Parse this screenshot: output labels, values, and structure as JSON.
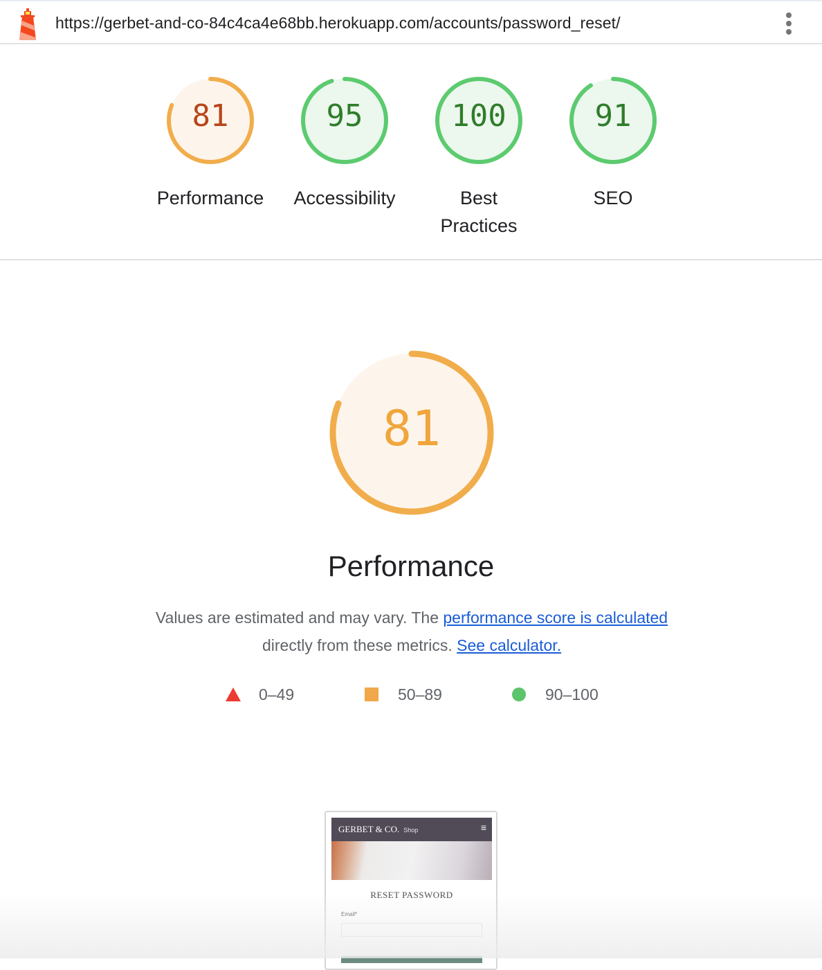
{
  "browser": {
    "url": "https://gerbet-and-co-84c4ca4e68bb.herokuapp.com/accounts/password_reset/",
    "logo_icon": "lighthouse-icon",
    "menu_icon": "kebab-menu-icon"
  },
  "categories": [
    {
      "score": "81",
      "score_value": 81,
      "label": "Performance",
      "status": "average"
    },
    {
      "score": "95",
      "score_value": 95,
      "label": "Accessibility",
      "status": "pass"
    },
    {
      "score": "100",
      "score_value": 100,
      "label": "Best Practices",
      "status": "pass"
    },
    {
      "score": "91",
      "score_value": 91,
      "label": "SEO",
      "status": "pass"
    }
  ],
  "performance": {
    "score": "81",
    "score_value": 81,
    "title": "Performance",
    "desc_prefix": "Values are estimated and may vary. The ",
    "link_score_calc": "performance score is calculated",
    "desc_middle": " directly from these metrics. ",
    "link_calculator": "See calculator."
  },
  "legend": [
    {
      "range": "0–49",
      "icon": "red-triangle-icon"
    },
    {
      "range": "50–89",
      "icon": "orange-square-icon"
    },
    {
      "range": "90–100",
      "icon": "green-circle-icon"
    }
  ],
  "thumbnail": {
    "brand": "GERBET & CO.",
    "shop": "Shop",
    "heading": "RESET PASSWORD",
    "email_label": "Email*"
  },
  "colors": {
    "average_stroke": "#f1ad4b",
    "average_fill": "#fdf5ec",
    "average_text": "#b8461b",
    "pass_stroke": "#5ccb6f",
    "pass_fill": "#ecf7ee",
    "pass_text": "#2f7d2a",
    "link": "#1a5cd6"
  }
}
